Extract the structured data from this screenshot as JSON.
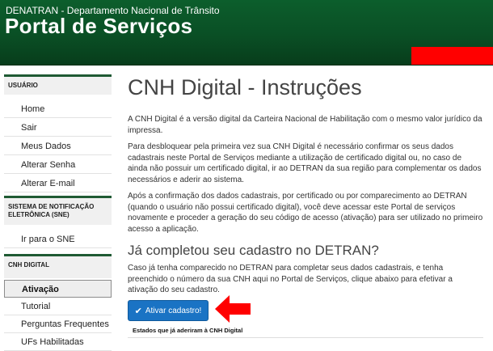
{
  "header": {
    "org": "DENATRAN - Departamento Nacional de Trânsito",
    "portal": "Portal de Serviços"
  },
  "sidebar": {
    "sections": [
      {
        "title": "USUÁRIO",
        "items": [
          "Home",
          "Sair",
          "Meus Dados",
          "Alterar Senha",
          "Alterar E-mail"
        ]
      },
      {
        "title": "SISTEMA DE NOTIFICAÇÃO ELETRÔNICA (SNE)",
        "items": [
          "Ir para o SNE"
        ]
      },
      {
        "title": "CNH DIGITAL",
        "items": [
          "Ativação",
          "Tutorial",
          "Perguntas Frequentes",
          "UFs Habilitadas"
        ]
      }
    ],
    "active_item": "Ativação"
  },
  "main": {
    "title": "CNH Digital - Instruções",
    "paragraphs": [
      "A CNH Digital é a versão digital da Carteira Nacional de Habilitação com o mesmo valor jurídico da impressa.",
      "Para desbloquear pela primeira vez sua CNH Digital é necessário confirmar os seus dados cadastrais neste Portal de Serviços mediante a utilização de certificado digital ou, no caso de ainda não possuir um certificado digital, ir ao DETRAN da sua região para complementar os dados necessários e aderir ao sistema.",
      "Após a confirmação dos dados cadastrais, por certificado ou por comparecimento ao DETRAN (quando o usuário não possui certificado digital), você deve acessar este Portal de serviços novamente e proceder a geração do seu código de acesso (ativação) para ser utilizado no primeiro acesso a aplicação."
    ],
    "subtitle": "Já completou seu cadastro no DETRAN?",
    "subtitle_text": "Caso já tenha comparecido no DETRAN para completar seus dados cadastrais, e tenha preenchido o número da sua CNH aqui no Portal de Serviços, clique abaixo para efetivar a ativação do seu cadastro.",
    "button_label": "Ativar cadastro!",
    "states_label": "Estados que já aderiram à CNH Digital"
  },
  "colors": {
    "header_green": "#0a4f25",
    "button_blue": "#1a73c4",
    "arrow_red": "#ff0000"
  },
  "icons": {
    "button_icon": "check-icon",
    "annotation": "arrow-left-icon"
  }
}
